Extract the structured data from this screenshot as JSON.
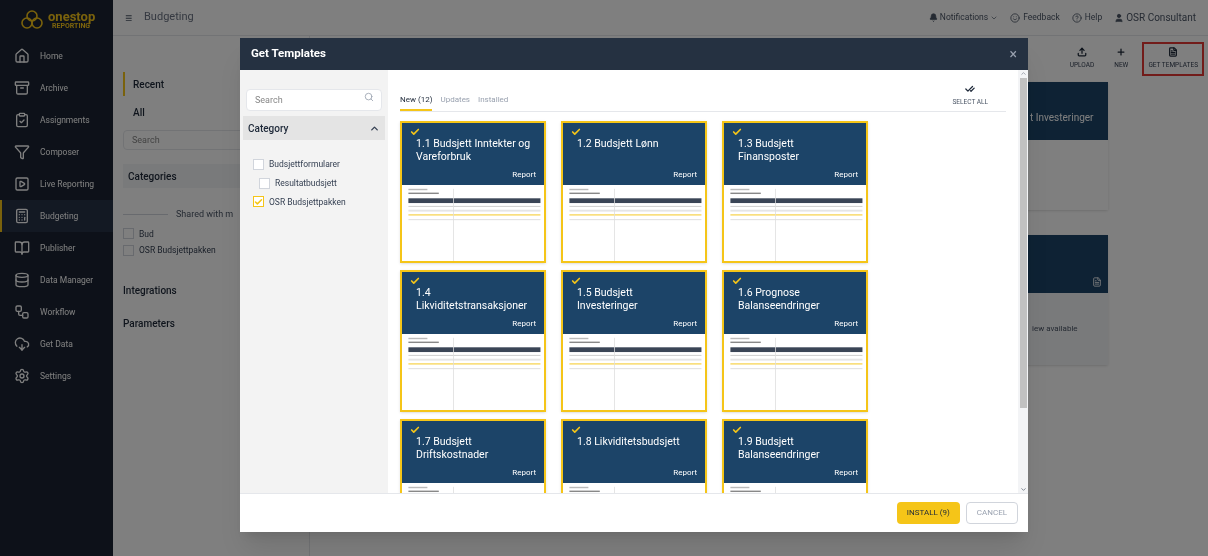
{
  "app": {
    "logo": {
      "name": "onestop",
      "tagline": "REPORTING"
    },
    "sidebar": {
      "items": [
        {
          "label": "Home",
          "selected": false
        },
        {
          "label": "Archive",
          "selected": false
        },
        {
          "label": "Assignments",
          "selected": false
        },
        {
          "label": "Composer",
          "selected": false
        },
        {
          "label": "Live Reporting",
          "selected": false
        },
        {
          "label": "Budgeting",
          "selected": true
        },
        {
          "label": "Publisher",
          "selected": false
        },
        {
          "label": "Data Manager",
          "selected": false
        },
        {
          "label": "Workflow",
          "selected": false
        },
        {
          "label": "Get Data",
          "selected": false
        },
        {
          "label": "Settings",
          "selected": false
        }
      ]
    },
    "topbar": {
      "menu_icon": "≡",
      "title": "Budgeting",
      "notifications": "Notifications",
      "feedback": "Feedback",
      "help": "Help",
      "user": "OSR Consultant"
    },
    "nav": {
      "items": [
        {
          "label": "Recent",
          "selected": true
        },
        {
          "label": "All",
          "selected": false
        }
      ],
      "search": {
        "placeholder": "Search"
      },
      "categories": "Categories",
      "shared_divider": "Shared with m",
      "shared": [
        {
          "label": "Bud",
          "checked": false
        },
        {
          "label": "OSR Budsjettpakken",
          "checked": false
        }
      ],
      "sections": [
        "Integrations",
        "Parameters"
      ]
    },
    "toolbar": [
      {
        "label": "UPLOAD",
        "highlighted": false
      },
      {
        "label": "NEW",
        "highlighted": false
      },
      {
        "label": "GET TEMPLATES",
        "highlighted": true
      }
    ],
    "background_cards": {
      "report_title": "t Investeringer",
      "empty_note": "iew available"
    }
  },
  "dialog": {
    "title": "Get Templates",
    "close": "×",
    "search": {
      "placeholder": "Search"
    },
    "category": {
      "title": "Category",
      "expanded": true,
      "items": [
        {
          "label": "Budsjettformularer",
          "checked": false,
          "children": [
            {
              "label": "Resultatbudsjett",
              "checked": false
            }
          ]
        },
        {
          "label": "OSR Budsjettpakken",
          "checked": true
        }
      ]
    },
    "tabs": [
      {
        "label": "New (12)",
        "selected": true
      },
      {
        "label": "Updates",
        "selected": false
      },
      {
        "label": "Installed",
        "selected": false
      }
    ],
    "select_all": "SELECT ALL",
    "templates": [
      {
        "title": "1.1 Budsjett Inntekter og Vareforbruk",
        "type": "Report",
        "checked": true
      },
      {
        "title": "1.2 Budsjett Lønn",
        "type": "Report",
        "checked": true
      },
      {
        "title": "1.3 Budsjett Finansposter",
        "type": "Report",
        "checked": true
      },
      {
        "title": "1.4 Likviditetstransaksjoner",
        "type": "Report",
        "checked": true
      },
      {
        "title": "1.5 Budsjett Investeringer",
        "type": "Report",
        "checked": true
      },
      {
        "title": "1.6 Prognose Balanseendringer",
        "type": "Report",
        "checked": true
      },
      {
        "title": "1.7 Budsjett Driftskostnader",
        "type": "Report",
        "checked": true
      },
      {
        "title": "1.8 Likviditetsbudsjett",
        "type": "Report",
        "checked": true
      },
      {
        "title": "1.9 Budsjett Balanseendringer",
        "type": "Report",
        "checked": true
      }
    ],
    "buttons": [
      {
        "label": "INSTALL (9)",
        "kind": "primary"
      },
      {
        "label": "CANCEL",
        "kind": "secondary"
      }
    ]
  }
}
